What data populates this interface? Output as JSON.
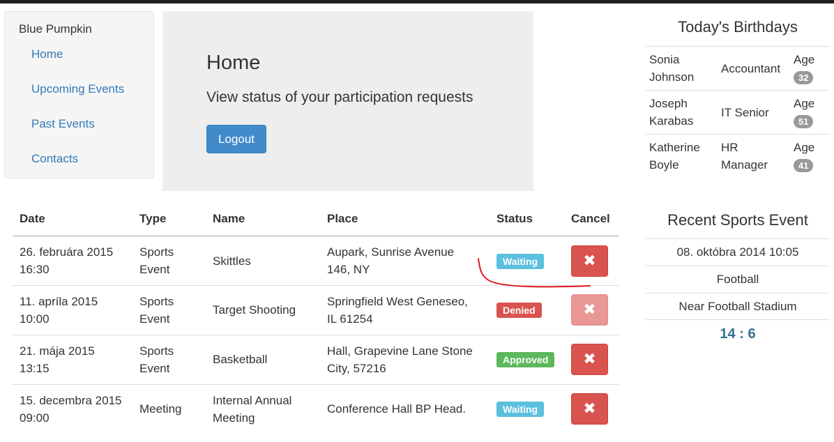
{
  "sidebar": {
    "brand": "Blue Pumpkin",
    "items": [
      {
        "label": "Home"
      },
      {
        "label": "Upcoming Events"
      },
      {
        "label": "Past Events"
      },
      {
        "label": "Contacts"
      }
    ]
  },
  "hero": {
    "title": "Home",
    "subtitle": "View status of your participation requests",
    "logout_label": "Logout"
  },
  "events": {
    "columns": [
      "Date",
      "Type",
      "Name",
      "Place",
      "Status",
      "Cancel"
    ],
    "rows": [
      {
        "date_line1": "26. februára 2015",
        "date_line2": "16:30",
        "type_line1": "Sports",
        "type_line2": "Event",
        "name_line1": "Skittles",
        "name_line2": "",
        "place_line1": "Aupark, Sunrise Avenue",
        "place_line2": "146, NY",
        "status": "Waiting",
        "cancel_icon": "✖"
      },
      {
        "date_line1": "11. apríla 2015",
        "date_line2": "10:00",
        "type_line1": "Sports",
        "type_line2": "Event",
        "name_line1": "Target Shooting",
        "name_line2": "",
        "place_line1": "Springfield West Geneseo,",
        "place_line2": "IL 61254",
        "status": "Denied",
        "cancel_icon": "✖"
      },
      {
        "date_line1": "21. mája 2015",
        "date_line2": "13:15",
        "type_line1": "Sports",
        "type_line2": "Event",
        "name_line1": "Basketball",
        "name_line2": "",
        "place_line1": "Hall, Grapevine Lane Stone",
        "place_line2": "City, 57216",
        "status": "Approved",
        "cancel_icon": "✖"
      },
      {
        "date_line1": "15. decembra 2015",
        "date_line2": "09:00",
        "type_line1": "Meeting",
        "type_line2": "",
        "name_line1": "Internal Annual",
        "name_line2": "Meeting",
        "place_line1": "Conference Hall BP Head.",
        "place_line2": "",
        "status": "Waiting",
        "cancel_icon": "✖"
      }
    ]
  },
  "birthdays": {
    "title": "Today's Birthdays",
    "age_label": "Age",
    "people": [
      {
        "first": "Sonia",
        "last": "Johnson",
        "role_line1": "Accountant",
        "role_line2": "",
        "age": "32"
      },
      {
        "first": "Joseph",
        "last": "Karabas",
        "role_line1": "IT Senior",
        "role_line2": "",
        "age": "51"
      },
      {
        "first": "Katherine",
        "last": "Boyle",
        "role_line1": "HR",
        "role_line2": "Manager",
        "age": "41"
      }
    ]
  },
  "recent_event": {
    "title": "Recent Sports Event",
    "datetime": "08. októbra 2014 10:05",
    "sport": "Football",
    "location": "Near Football Stadium",
    "score": "14 : 6"
  },
  "colors": {
    "link": "#337ab7",
    "primary": "#428bca",
    "waiting": "#5bc0de",
    "denied": "#d9534f",
    "approved": "#5cb85c",
    "annotation": "#e0191e"
  }
}
